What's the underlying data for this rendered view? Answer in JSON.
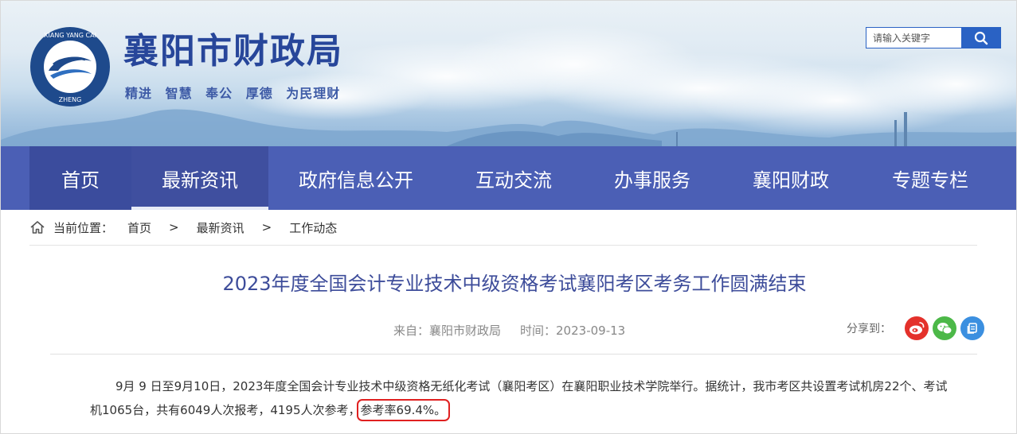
{
  "header": {
    "site_title": "襄阳市财政局",
    "slogan": "精进  智慧  奉公  厚德  为民理财",
    "logo_ring_text": "XIANG YANG CAI ZHENG",
    "search_placeholder": "请输入关键字"
  },
  "nav": {
    "items": [
      {
        "label": "首页"
      },
      {
        "label": "最新资讯"
      },
      {
        "label": "政府信息公开"
      },
      {
        "label": "互动交流"
      },
      {
        "label": "办事服务"
      },
      {
        "label": "襄阳财政"
      },
      {
        "label": "专题专栏"
      }
    ]
  },
  "breadcrumb": {
    "prefix": "当前位置：",
    "items": [
      "首页",
      "最新资讯",
      "工作动态"
    ],
    "separator": ">"
  },
  "article": {
    "title": "2023年度全国会计专业技术中级资格考试襄阳考区考务工作圆满结束",
    "source": "来自：襄阳市财政局",
    "time": "时间：2023-09-13",
    "share_label": "分享到：",
    "body_main": "9月 9 日至9月10日，2023年度全国会计专业技术中级资格无纸化考试（襄阳考区）在襄阳职业技术学院举行。据统计，我市考区共设置考试机房22个、考试机1065台，共有6049人次报考，4195人次参考，",
    "body_highlight": "参考率69.4%。"
  },
  "colors": {
    "nav_bg": "#4b5fb5",
    "title_blue": "#27469a",
    "article_title": "#3d4c9a",
    "highlight_box": "#e02020"
  }
}
